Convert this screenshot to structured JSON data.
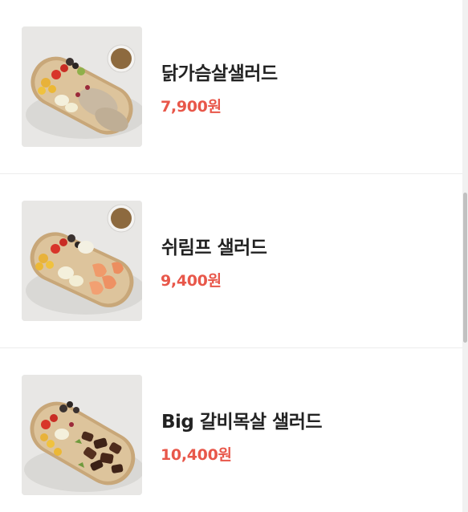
{
  "menu": {
    "items": [
      {
        "name": "닭가슴살샐러드",
        "price": "7,900원",
        "image_icon": "chicken-breast-salad-photo"
      },
      {
        "name": "쉬림프 샐러드",
        "price": "9,400원",
        "image_icon": "shrimp-salad-photo"
      },
      {
        "name": "Big 갈비목살 샐러드",
        "price": "10,400원",
        "image_icon": "galbi-moksal-salad-photo"
      }
    ]
  },
  "colors": {
    "price": "#e8574a",
    "name": "#222222",
    "divider": "#ececec"
  }
}
